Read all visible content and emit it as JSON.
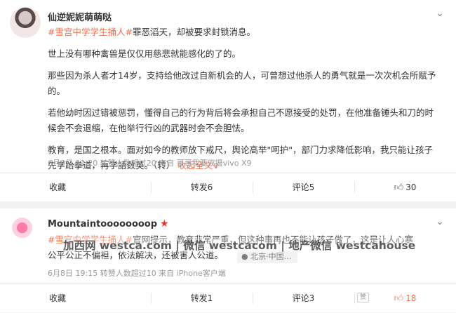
{
  "posts": [
    {
      "author": "仙逆妮妮萌萌哒",
      "paragraphs": [
        {
          "tag": "#雪宫中学学生捅人#",
          "text": "罪恶滔天，却被要求封锁消息。"
        },
        {
          "text": "世上没有哪种禽兽是仅仅用慈悲就能感化的了的。"
        },
        {
          "text": "那些因为杀人者才14岁，支持给他改过自新机会的人，可曾想过他杀人的勇气就是一次次机会所赋予的。"
        },
        {
          "text": "若他幼时因过错被惩罚，懂得自己的行为背后将会承担自己不愿接受的处罚，在他准备锤头和刀的时候会不会退缩，在他举行行凶的武器时会不会胆怯。"
        },
        {
          "text": "教育，是国之根本。面对如今的教师放下戒尺，舆论高举\"呵护\"，部门力求降低影响，我只能让孩子先学跆拳道，再学語数英。（转）",
          "link": "收起全文∨"
        }
      ],
      "meta": "6月9日 11:20 转赞人数超过20 来自 哥哥我要双摄vivo X9",
      "actions": {
        "fav": "收藏",
        "repost": "转发6",
        "comment": "评论5",
        "like": "30"
      }
    },
    {
      "author": "Mountaintoooooooop",
      "vip_icon": "star-icon",
      "line1": {
        "tag": "#雪宫中学学生捅人#",
        "text": "官网提示，教育非常严重，但这种事再也不能让孩子做了，这是让人心寒…希望"
      },
      "line2": "公平公正不偏袒，依法解决，还被害人公道。",
      "location": "北京·中国…",
      "meta": "6月8日 19:15 转赞人数超过10 来自 iPhone客户端",
      "actions": {
        "fav": "收藏",
        "repost": "转发1",
        "comment": "评论3",
        "like": "18"
      },
      "praise_badge": "赞"
    }
  ],
  "watermark": "加西网 westca.com | 微信 westcacom | 地产微信 westcahouse",
  "colors": {
    "accent": "#eb7350",
    "vip": "#f0302a"
  }
}
